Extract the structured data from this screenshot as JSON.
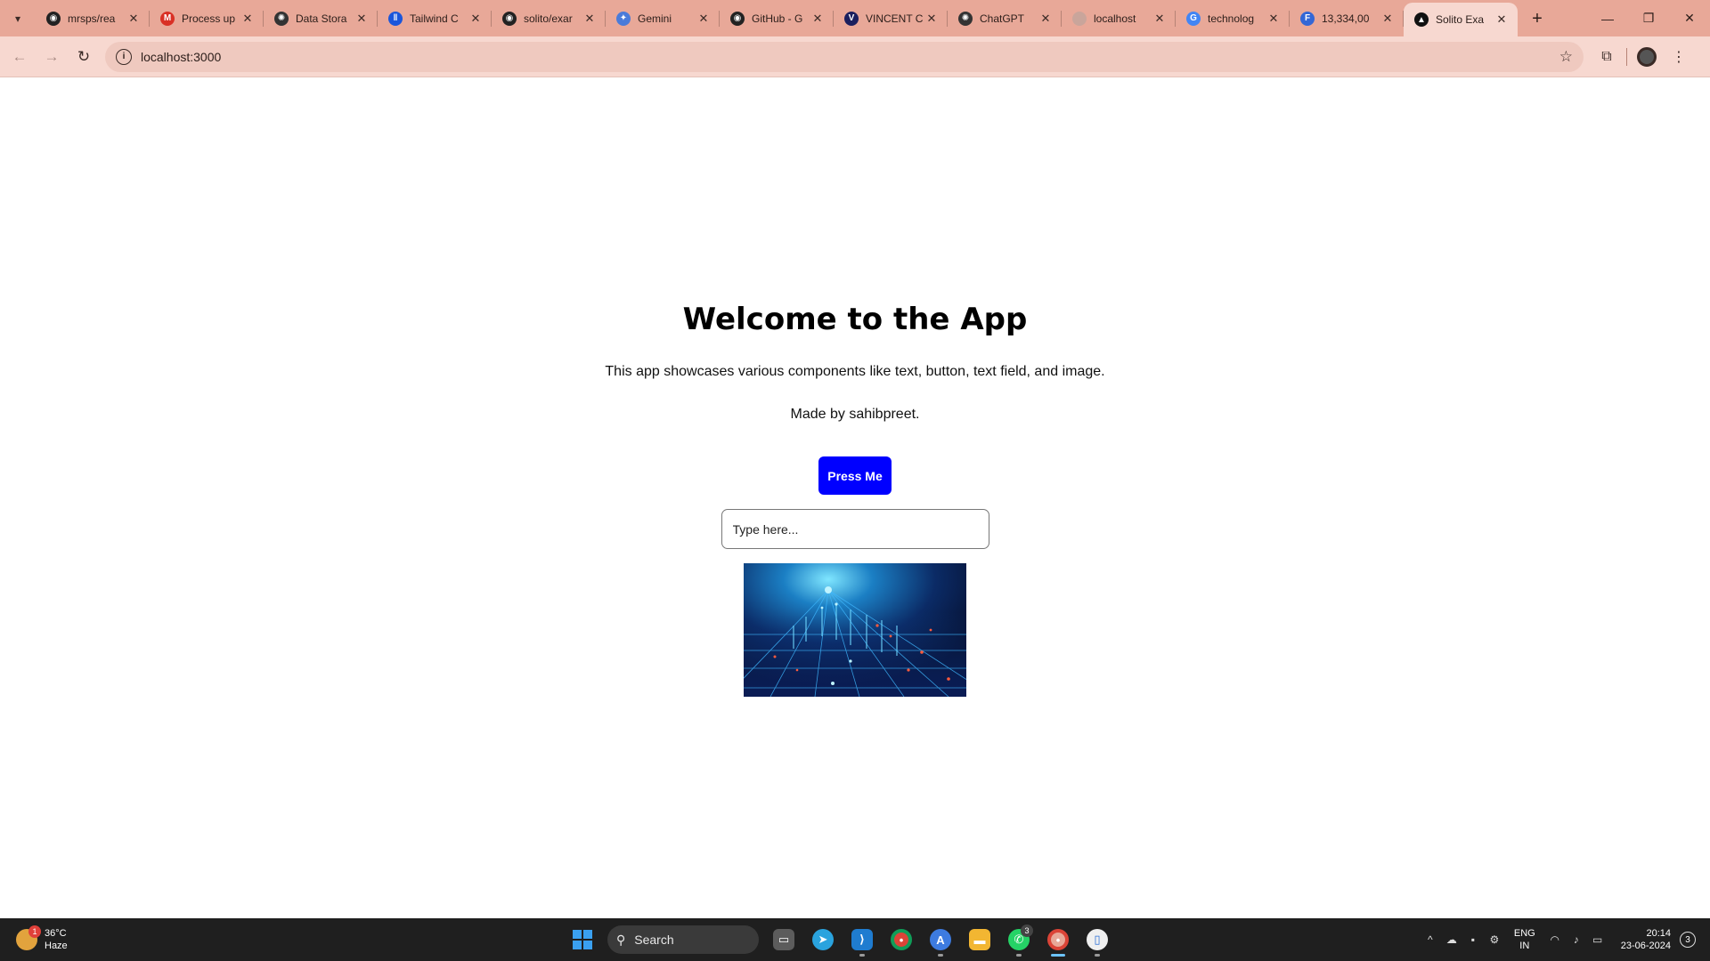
{
  "browser": {
    "tabs": [
      {
        "title": "mrsps/rea",
        "favicon_color": "#222222",
        "favicon_glyph": "◉",
        "icon": "github-icon"
      },
      {
        "title": "Process up",
        "favicon_color": "#d93025",
        "favicon_glyph": "M",
        "icon": "gmail-icon"
      },
      {
        "title": "Data Stora",
        "favicon_color": "#333333",
        "favicon_glyph": "✺",
        "icon": "openai-icon"
      },
      {
        "title": "Tailwind C",
        "favicon_color": "#1a56db",
        "favicon_glyph": "‖",
        "icon": "tailwind-icon"
      },
      {
        "title": "solito/exar",
        "favicon_color": "#222222",
        "favicon_glyph": "◉",
        "icon": "github-icon"
      },
      {
        "title": "Gemini",
        "favicon_color": "#4a7bd9",
        "favicon_glyph": "✦",
        "icon": "gemini-icon"
      },
      {
        "title": "GitHub - G",
        "favicon_color": "#222222",
        "favicon_glyph": "◉",
        "icon": "github-icon"
      },
      {
        "title": "VINCENT C",
        "favicon_color": "#1b1f5e",
        "favicon_glyph": "V",
        "icon": "vincent-icon"
      },
      {
        "title": "ChatGPT",
        "favicon_color": "#333333",
        "favicon_glyph": "✺",
        "icon": "openai-icon"
      },
      {
        "title": "localhost",
        "favicon_color": "#c9a59b",
        "favicon_glyph": "",
        "icon": "globe-icon"
      },
      {
        "title": "technolog",
        "favicon_color": "#4285f4",
        "favicon_glyph": "G",
        "icon": "google-icon"
      },
      {
        "title": "13,334,00",
        "favicon_color": "#3367d6",
        "favicon_glyph": "F",
        "icon": "docs-icon"
      },
      {
        "title": "Solito Exa",
        "favicon_color": "#111111",
        "favicon_glyph": "▲",
        "icon": "solito-icon",
        "active": true
      }
    ],
    "url": "localhost:3000"
  },
  "page": {
    "title": "Welcome to the App",
    "description": "This app showcases various components like text, button, text field, and image.",
    "credit": "Made by sahibpreet.",
    "button_label": "Press Me",
    "input_placeholder": "Type here..."
  },
  "taskbar": {
    "weather_temp": "36°C",
    "weather_cond": "Haze",
    "weather_badge": "1",
    "search_label": "Search",
    "whatsapp_badge": "3",
    "lang_line1": "ENG",
    "lang_line2": "IN",
    "time": "20:14",
    "date": "23-06-2024",
    "notifications": "3"
  }
}
